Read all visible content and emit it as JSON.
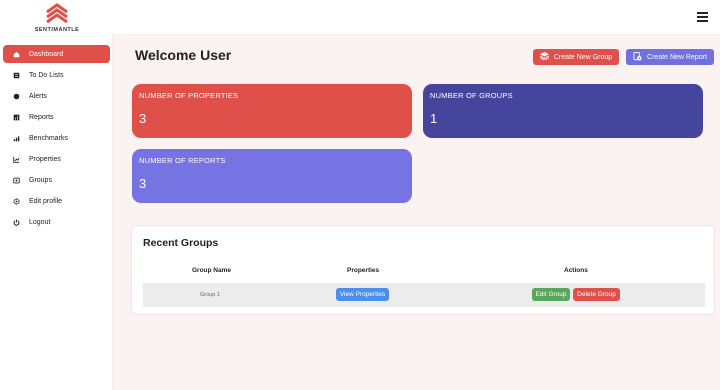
{
  "brand": {
    "name": "SENTIMANTLE",
    "logo_color": "#e0504b"
  },
  "header": {
    "menu_icon": "hamburger-icon"
  },
  "sidebar": {
    "items": [
      {
        "label": "Dashboard",
        "icon": "home-icon",
        "active": true
      },
      {
        "label": "To Do Lists",
        "icon": "list-icon"
      },
      {
        "label": "Alerts",
        "icon": "alert-icon"
      },
      {
        "label": "Reports",
        "icon": "report-icon"
      },
      {
        "label": "Benchmarks",
        "icon": "bar-chart-icon"
      },
      {
        "label": "Properties",
        "icon": "line-chart-icon"
      },
      {
        "label": "Groups",
        "icon": "groups-icon"
      },
      {
        "label": "Edit profile",
        "icon": "gear-icon"
      },
      {
        "label": "Logout",
        "icon": "power-icon"
      }
    ]
  },
  "main": {
    "title": "Welcome User",
    "actions": {
      "create_group": "Create New Group",
      "create_report": "Create New Report"
    },
    "stats": [
      {
        "label": "NUMBER OF PROPERTIES",
        "value": "3",
        "color": "#e0504b"
      },
      {
        "label": "NUMBER OF GROUPS",
        "value": "1",
        "color": "#45459e"
      },
      {
        "label": "NUMBER OF REPORTS",
        "value": "3",
        "color": "#7674e2"
      }
    ],
    "recent_groups": {
      "title": "Recent Groups",
      "columns": [
        "Group Name",
        "Properties",
        "Actions"
      ],
      "rows": [
        {
          "name": "Group 1",
          "view_label": "View Properties",
          "edit_label": "Edit Group",
          "delete_label": "Delete Group"
        }
      ]
    }
  }
}
